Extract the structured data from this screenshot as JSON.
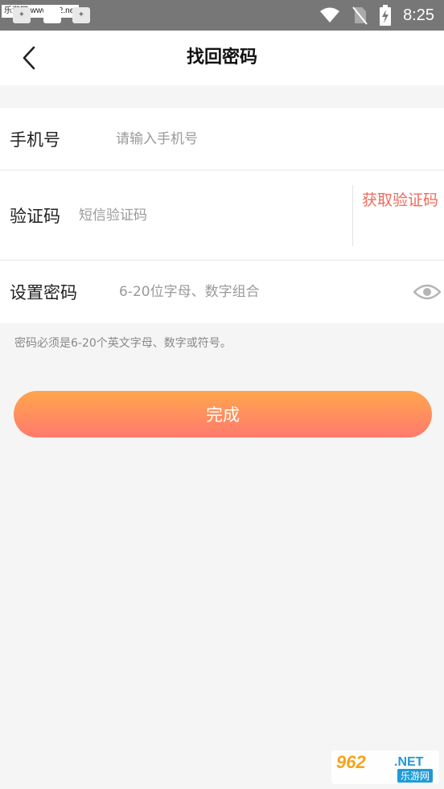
{
  "status_bar": {
    "watermark": "乐游网 www.962.net",
    "time": "8:25",
    "icons": [
      "wifi-icon",
      "no-sim-icon",
      "battery-charging-icon"
    ]
  },
  "header": {
    "title": "找回密码",
    "back_icon": "back-chevron-icon"
  },
  "form": {
    "phone": {
      "label": "手机号",
      "placeholder": "请输入手机号",
      "value": ""
    },
    "code": {
      "label": "验证码",
      "placeholder": "短信验证码",
      "value": "",
      "get_code_label": "获取验证码"
    },
    "password": {
      "label": "设置密码",
      "placeholder": "6-20位字母、数字组合",
      "value": "",
      "toggle_icon": "eye-icon"
    }
  },
  "hint": "密码必须是6-20个英文字母、数字或符号。",
  "submit_label": "完成",
  "watermark_bottom": {
    "logo": "962",
    "net": ".NET",
    "sub": "乐游网"
  },
  "colors": {
    "accent_red": "#f06a5a",
    "button_gradient_top": "#ffa64d",
    "button_gradient_bottom": "#ff7a6d",
    "status_bar_bg": "#777777"
  }
}
